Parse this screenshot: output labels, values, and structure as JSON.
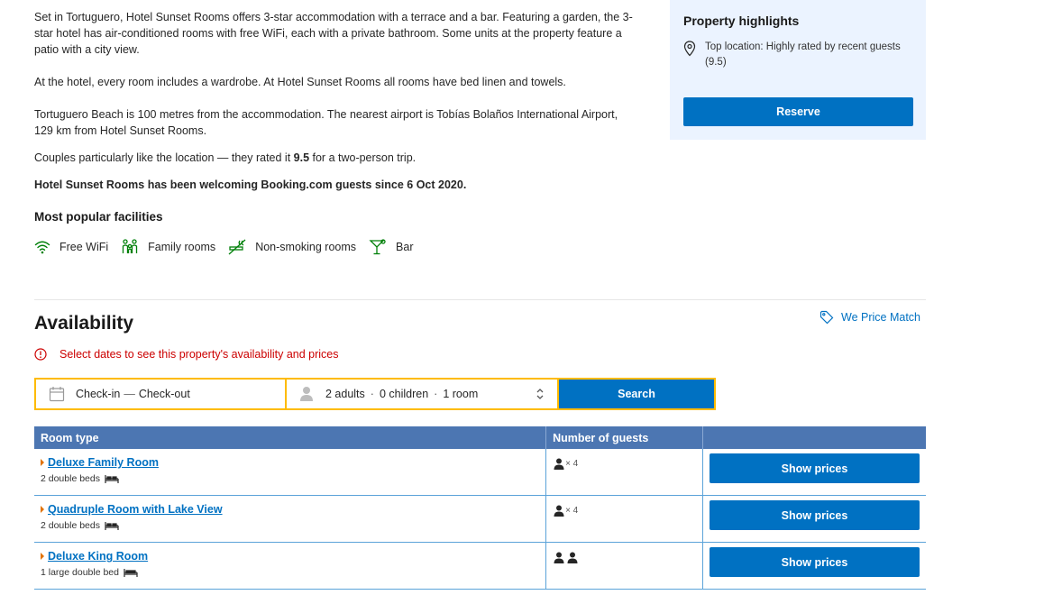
{
  "description": {
    "p1": "Set in Tortuguero, Hotel Sunset Rooms offers 3-star accommodation with a terrace and a bar. Featuring a garden, the 3-star hotel has air-conditioned rooms with free WiFi, each with a private bathroom. Some units at the property feature a patio with a city view.",
    "p2": "At the hotel, every room includes a wardrobe. At Hotel Sunset Rooms all rooms have bed linen and towels.",
    "p3": "Tortuguero Beach is 100 metres from the accommodation. The nearest airport is Tobías Bolaños International Airport, 129 km from Hotel Sunset Rooms.",
    "couples_pre": "Couples particularly like the location — they rated it ",
    "couples_score": "9.5",
    "couples_post": " for a two-person trip.",
    "since": "Hotel Sunset Rooms has been welcoming Booking.com guests since 6 Oct 2020."
  },
  "facilities": {
    "title": "Most popular facilities",
    "items": [
      {
        "label": "Free WiFi",
        "icon": "wifi-icon"
      },
      {
        "label": "Family rooms",
        "icon": "family-icon"
      },
      {
        "label": "Non-smoking rooms",
        "icon": "no-smoking-icon"
      },
      {
        "label": "Bar",
        "icon": "cocktail-icon"
      }
    ],
    "icon_color": "#008009"
  },
  "highlights": {
    "title": "Property highlights",
    "location_text": "Top location: Highly rated by recent guests (9.5)",
    "reserve_label": "Reserve"
  },
  "availability": {
    "title": "Availability",
    "price_match": "We Price Match",
    "alert": "Select dates to see this property's availability and prices",
    "checkin": "Check-in",
    "checkout": "Check-out",
    "adults": "2 adults",
    "children": "0 children",
    "rooms": "1 room",
    "search_label": "Search"
  },
  "table": {
    "headers": [
      "Room type",
      "Number of guests",
      ""
    ],
    "rows": [
      {
        "name": "Deluxe Family Room",
        "beds": "2 double beds",
        "guests": "× 4",
        "button": "Show prices"
      },
      {
        "name": "Quadruple Room with Lake View",
        "beds": "2 double beds",
        "guests": "× 4",
        "button": "Show prices"
      },
      {
        "name": "Deluxe King Room",
        "beds": "1 large double bed",
        "guests": "",
        "button": "Show prices"
      }
    ]
  },
  "colors": {
    "brand_blue": "#0071c2",
    "header_blue": "#4c76b2",
    "search_border": "#febb02",
    "alert_red": "#cc0000",
    "highlight_bg": "#ebf3ff"
  }
}
